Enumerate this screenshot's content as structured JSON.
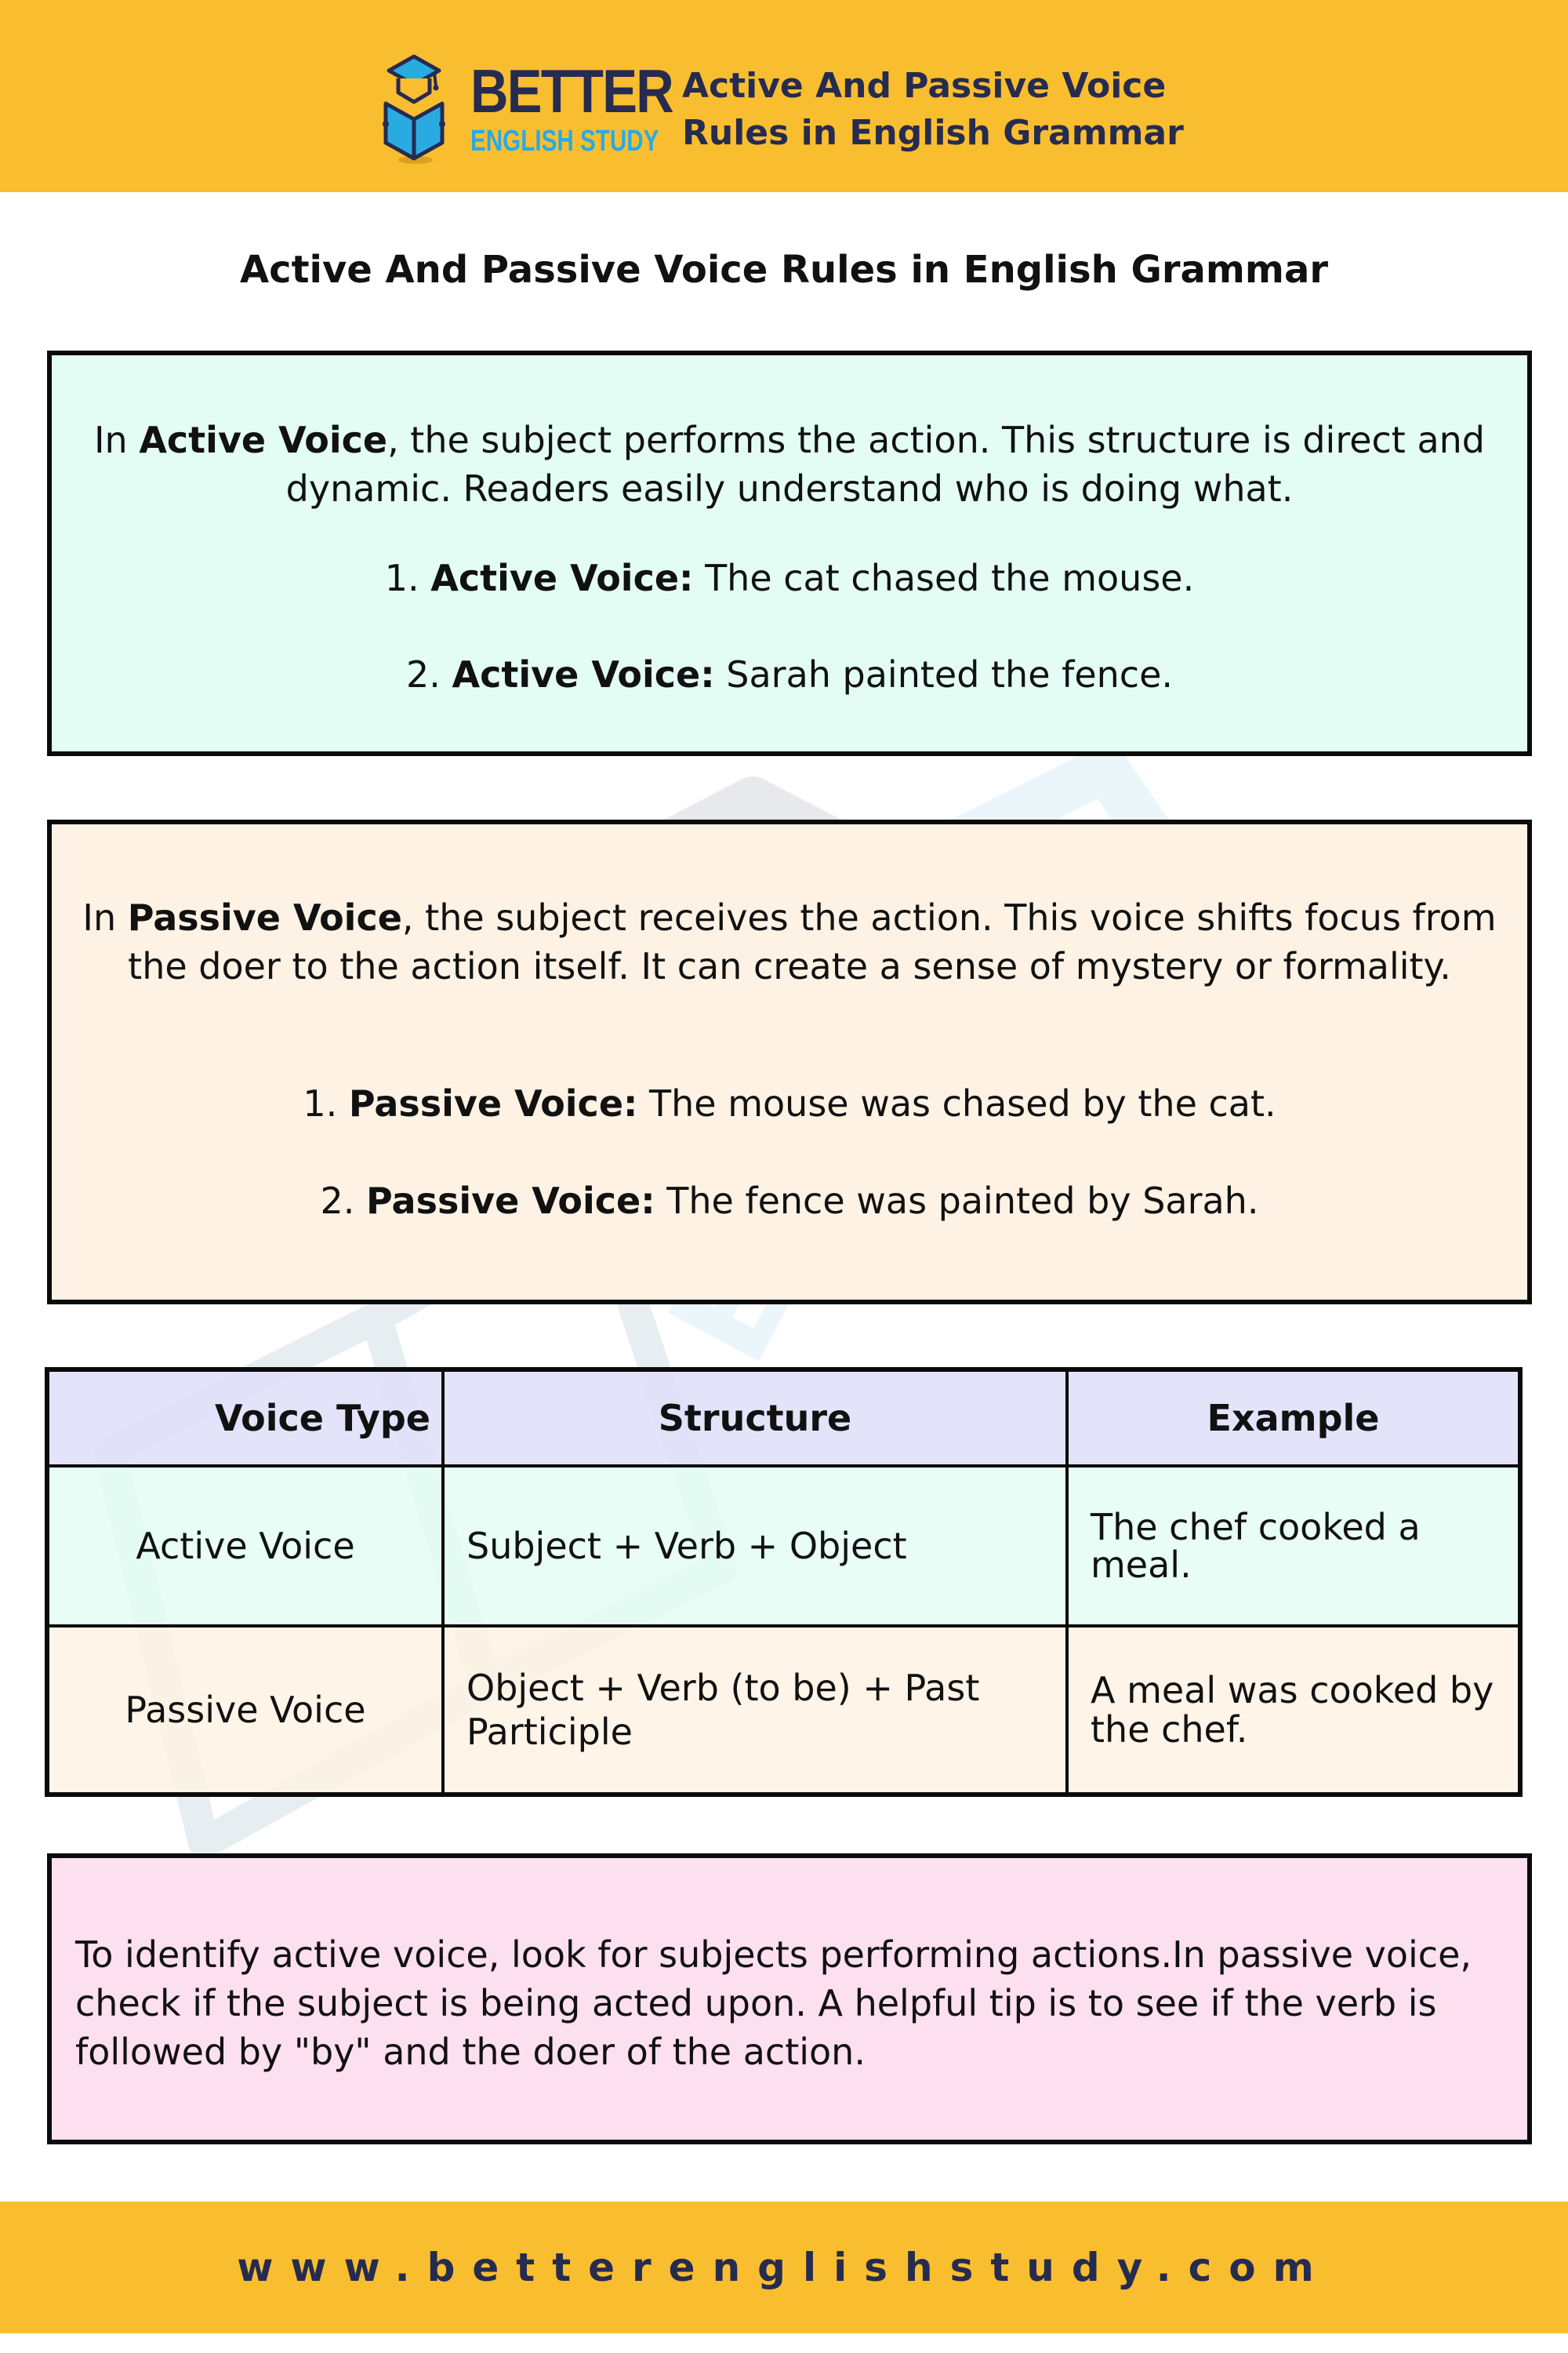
{
  "header": {
    "brand_top": "BETTER",
    "brand_bottom": "ENGLISH STUDY",
    "title_line1": "Active And Passive Voice",
    "title_line2": "Rules in English Grammar",
    "logo_icon": "graduation-cap-book-icon"
  },
  "page_title": "Active And Passive Voice Rules in English Grammar",
  "active_box": {
    "intro_prefix": "In ",
    "intro_bold": "Active Voice",
    "intro_rest": ", the subject performs the action. This structure is direct and dynamic. Readers easily understand who is doing what.",
    "examples": [
      {
        "num": "1.",
        "label": "Active Voice:",
        "text": "The cat chased the mouse."
      },
      {
        "num": "2.",
        "label": "Active Voice:",
        "text": "Sarah painted the fence."
      }
    ]
  },
  "passive_box": {
    "intro_prefix": "In ",
    "intro_bold": "Passive Voice",
    "intro_rest": ", the subject receives the action. This voice shifts focus from the doer to the action itself. It can create a sense of mystery or formality.",
    "examples": [
      {
        "num": "1.",
        "label": "Passive Voice:",
        "text": "The mouse was chased by the cat."
      },
      {
        "num": "2.",
        "label": "Passive Voice:",
        "text": "The fence was painted by Sarah."
      }
    ]
  },
  "table": {
    "headers": [
      "Voice Type",
      "Structure",
      "Example"
    ],
    "rows": [
      {
        "type": "Active Voice",
        "structure": "Subject + Verb + Object",
        "example": "The chef cooked a meal."
      },
      {
        "type": "Passive Voice",
        "structure": "Object + Verb (to be) + Past Participle",
        "example": "A meal was cooked by the chef."
      }
    ]
  },
  "tip_box": {
    "text": "To identify active voice, look for subjects performing actions.In passive voice, check if the subject is being acted upon. A helpful tip is to see if the verb is followed by \"by\" and the doer of the action."
  },
  "footer": {
    "url": "www.betterenglishstudy.com"
  },
  "colors": {
    "brand_yellow": "#F9BE2F",
    "brand_navy": "#262B50",
    "brand_blue": "#29ABE2",
    "active_bg": "#E3FDF5",
    "passive_bg": "#FEF2E4",
    "header_row_bg": "#E0E0FA",
    "tip_bg": "#FDE0F0"
  }
}
